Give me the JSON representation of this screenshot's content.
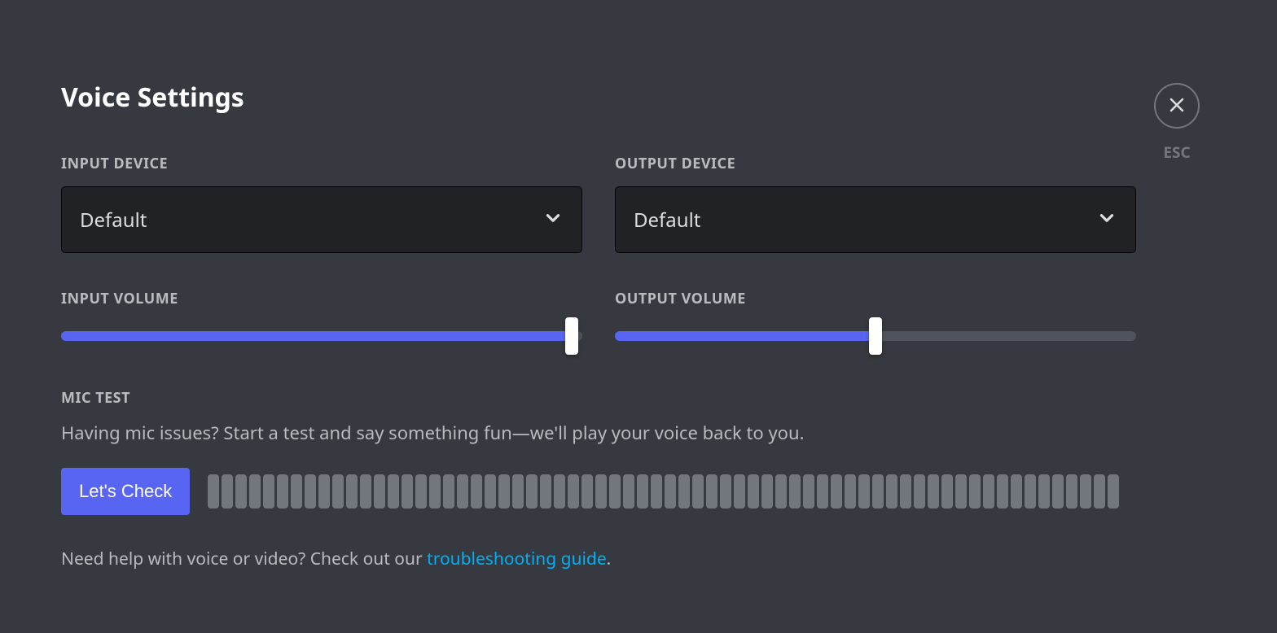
{
  "title": "Voice Settings",
  "close": {
    "esc_label": "ESC"
  },
  "input_device": {
    "label": "INPUT DEVICE",
    "selected": "Default"
  },
  "output_device": {
    "label": "OUTPUT DEVICE",
    "selected": "Default"
  },
  "input_volume": {
    "label": "INPUT VOLUME",
    "percent": 98
  },
  "output_volume": {
    "label": "OUTPUT VOLUME",
    "percent": 50
  },
  "mic_test": {
    "label": "MIC TEST",
    "description": "Having mic issues? Start a test and say something fun—we'll play your voice back to you.",
    "button_label": "Let's Check",
    "bar_count": 66
  },
  "help": {
    "prefix": "Need help with voice or video? Check out our ",
    "link_text": "troubleshooting guide",
    "suffix": "."
  }
}
